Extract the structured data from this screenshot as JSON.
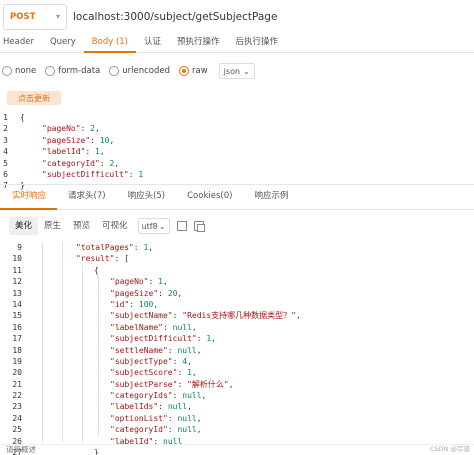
{
  "request": {
    "method": "POST",
    "url": "localhost:3000/subject/getSubjectPage"
  },
  "request_tabs": [
    {
      "label": "Header"
    },
    {
      "label": "Query"
    },
    {
      "label": "Body (1)"
    },
    {
      "label": "认证"
    },
    {
      "label": "预执行操作"
    },
    {
      "label": "后执行操作"
    }
  ],
  "body_types": [
    {
      "label": "none"
    },
    {
      "label": "form-data"
    },
    {
      "label": "urlencoded"
    },
    {
      "label": "raw"
    }
  ],
  "format_select": "json",
  "refresh_button": "点击更新",
  "request_body": {
    "lines": [
      {
        "no": "1",
        "text": "{"
      },
      {
        "no": "2",
        "key": "\"pageNo\"",
        "value": "2",
        "end": ","
      },
      {
        "no": "3",
        "key": "\"pageSize\"",
        "value": "10",
        "end": ","
      },
      {
        "no": "4",
        "key": "\"labelId\"",
        "value": "1",
        "end": ","
      },
      {
        "no": "5",
        "key": "\"categoryId\"",
        "value": "2",
        "end": ","
      },
      {
        "no": "6",
        "key": "\"subjectDifficult\"",
        "value": "1",
        "end": ""
      },
      {
        "no": "7",
        "text": "}"
      }
    ]
  },
  "response_tabs": [
    {
      "label": "实时响应"
    },
    {
      "label": "请求头(7)"
    },
    {
      "label": "响应头(5)"
    },
    {
      "label": "Cookies(0)"
    },
    {
      "label": "响应示例"
    }
  ],
  "view_tabs": [
    {
      "label": "美化"
    },
    {
      "label": "原生"
    },
    {
      "label": "预览"
    },
    {
      "label": "可视化"
    }
  ],
  "encoding": "utf8",
  "response_body": {
    "lines": [
      {
        "no": "9",
        "indent": 2,
        "key": "\"totalPages\"",
        "value": "1",
        "end": ","
      },
      {
        "no": "10",
        "indent": 2,
        "key": "\"result\"",
        "value": "[",
        "end": ""
      },
      {
        "no": "11",
        "indent": 3,
        "text": "{"
      },
      {
        "no": "12",
        "indent": 4,
        "key": "\"pageNo\"",
        "value": "1",
        "end": ","
      },
      {
        "no": "13",
        "indent": 4,
        "key": "\"pageSize\"",
        "value": "20",
        "end": ","
      },
      {
        "no": "14",
        "indent": 4,
        "key": "\"id\"",
        "value": "100",
        "end": ","
      },
      {
        "no": "15",
        "indent": 4,
        "key": "\"subjectName\"",
        "value": "\"Redis支持哪几种数据类型？\"",
        "end": ","
      },
      {
        "no": "16",
        "indent": 4,
        "key": "\"labelName\"",
        "value": "null",
        "end": ","
      },
      {
        "no": "17",
        "indent": 4,
        "key": "\"subjectDifficult\"",
        "value": "1",
        "end": ","
      },
      {
        "no": "18",
        "indent": 4,
        "key": "\"settleName\"",
        "value": "null",
        "end": ","
      },
      {
        "no": "19",
        "indent": 4,
        "key": "\"subjectType\"",
        "value": "4",
        "end": ","
      },
      {
        "no": "20",
        "indent": 4,
        "key": "\"subjectScore\"",
        "value": "1",
        "end": ","
      },
      {
        "no": "21",
        "indent": 4,
        "key": "\"subjectParse\"",
        "value": "\"解析什么\"",
        "end": ","
      },
      {
        "no": "22",
        "indent": 4,
        "key": "\"categoryIds\"",
        "value": "null",
        "end": ","
      },
      {
        "no": "23",
        "indent": 4,
        "key": "\"labelIds\"",
        "value": "null",
        "end": ","
      },
      {
        "no": "24",
        "indent": 4,
        "key": "\"optionList\"",
        "value": "null",
        "end": ","
      },
      {
        "no": "25",
        "indent": 4,
        "key": "\"categoryId\"",
        "value": "null",
        "end": ","
      },
      {
        "no": "26",
        "indent": 4,
        "key": "\"labelId\"",
        "value": "null",
        "end": ""
      },
      {
        "no": "27",
        "indent": 3,
        "text": "}"
      }
    ]
  },
  "footer_text": "请简概述",
  "watermark": "CSDN @宗谱"
}
